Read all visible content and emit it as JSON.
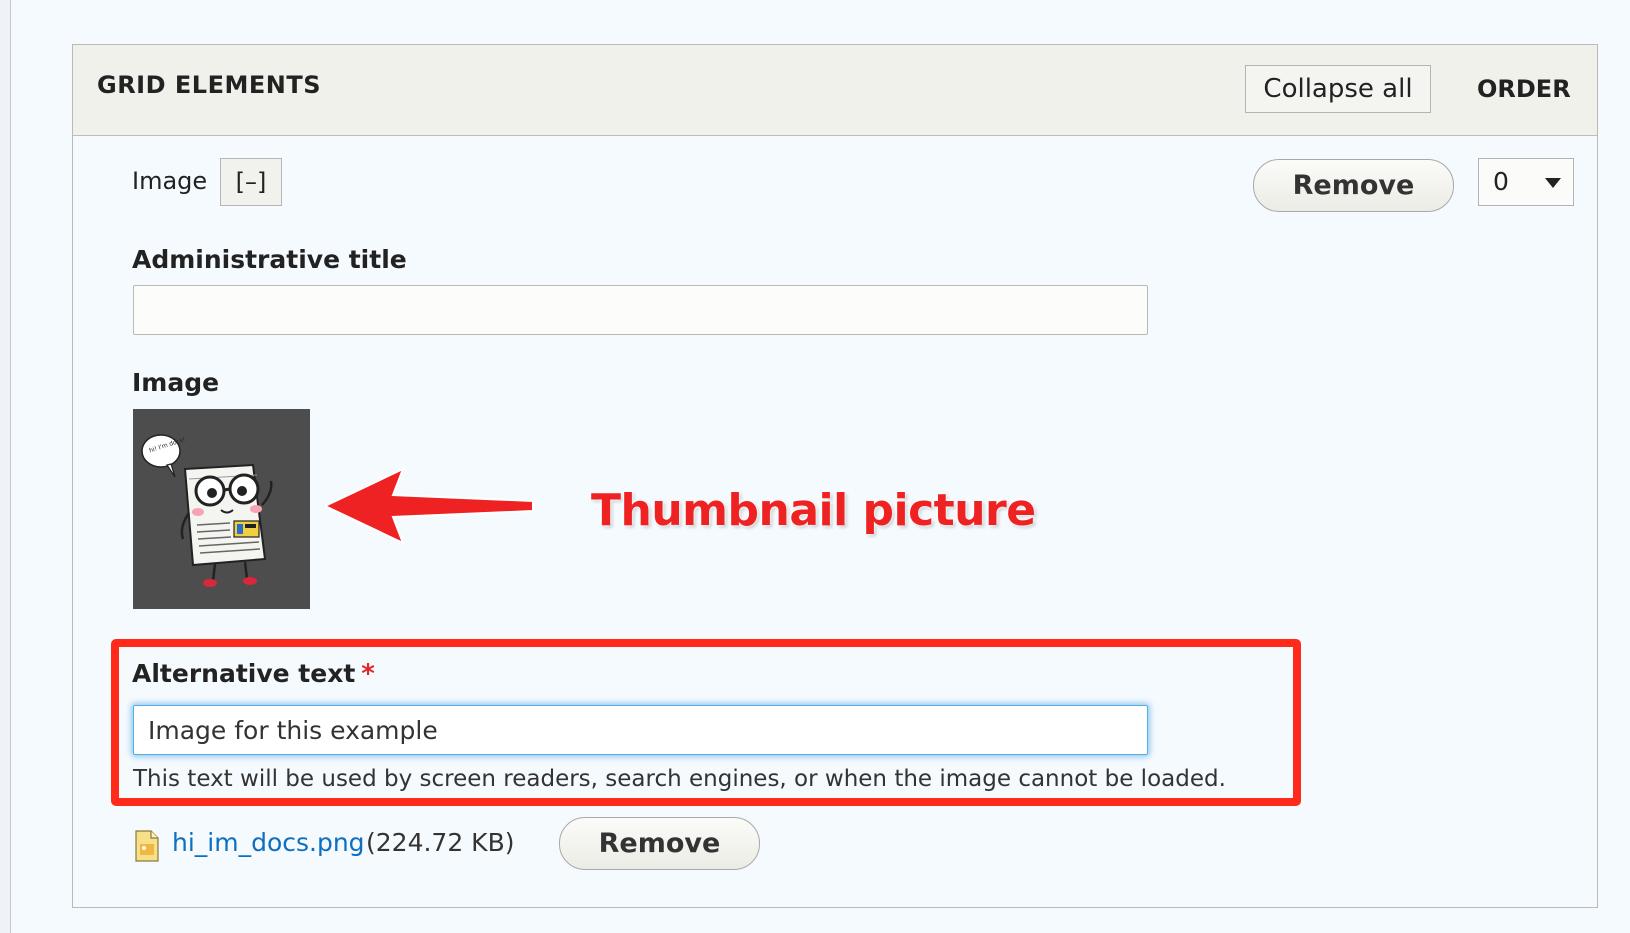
{
  "header": {
    "title": "GRID ELEMENTS",
    "collapse_all_label": "Collapse all",
    "order_label": "ORDER"
  },
  "row": {
    "label": "Image",
    "toggle_label": "[–]",
    "remove_label": "Remove",
    "order_value": "0"
  },
  "fields": {
    "admin_title_label": "Administrative title",
    "admin_title_value": "",
    "image_label": "Image",
    "alt_text_label": "Alternative text",
    "alt_text_required_mark": "*",
    "alt_text_value": "Image for this example",
    "alt_text_help": "This text will be used by screen readers, search engines, or when the image cannot be loaded."
  },
  "file": {
    "name": "hi_im_docs.png",
    "size": "(224.72 KB)",
    "remove_label": "Remove"
  },
  "annotation": {
    "text": "Thumbnail picture"
  },
  "thumbnail": {
    "bubble_text": "hi! I'm docs!"
  },
  "colors": {
    "annotation_red": "#ee2222",
    "highlight_border": "#ff2a1a",
    "link_blue": "#0d6fc0",
    "focus_blue": "#55aee8",
    "header_bg": "#f1f1ec",
    "page_bg": "#f5fafe"
  },
  "icons": {
    "file": "file-image-icon",
    "arrow": "arrow-left-icon",
    "caret": "chevron-down-icon"
  }
}
